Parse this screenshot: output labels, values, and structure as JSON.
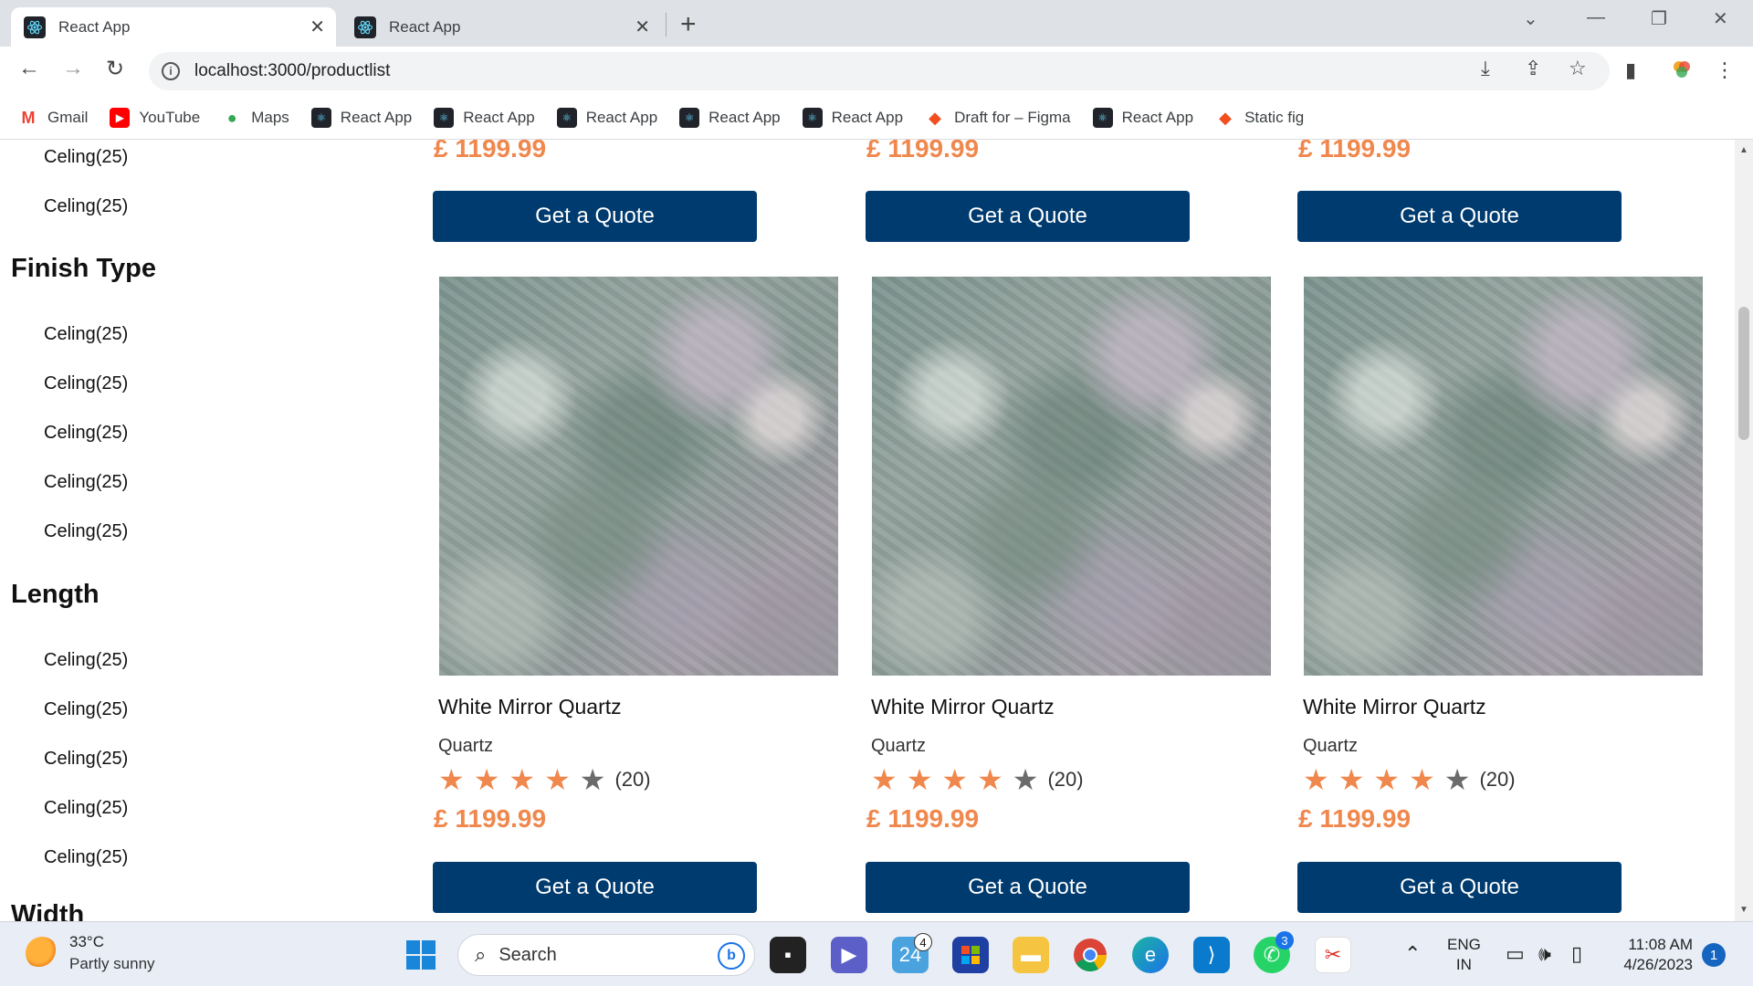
{
  "browser": {
    "tabs": [
      {
        "title": "React App",
        "active": true
      },
      {
        "title": "React App",
        "active": false
      }
    ],
    "new_tab": "+",
    "url": "localhost:3000/productlist",
    "bookmarks": [
      {
        "label": "Gmail",
        "icon": "gmail-icon",
        "color": "#ea4335"
      },
      {
        "label": "YouTube",
        "icon": "youtube-icon",
        "color": "#ff0000"
      },
      {
        "label": "Maps",
        "icon": "maps-icon",
        "color": "#34a853"
      },
      {
        "label": "React App",
        "icon": "react-icon",
        "color": "#20232a"
      },
      {
        "label": "React App",
        "icon": "react-icon",
        "color": "#20232a"
      },
      {
        "label": "React App",
        "icon": "react-icon",
        "color": "#20232a"
      },
      {
        "label": "React App",
        "icon": "react-icon",
        "color": "#20232a"
      },
      {
        "label": "React App",
        "icon": "react-icon",
        "color": "#20232a"
      },
      {
        "label": "Draft for – Figma",
        "icon": "figma-icon",
        "color": "#f24e1e"
      },
      {
        "label": "React App",
        "icon": "react-icon",
        "color": "#20232a"
      },
      {
        "label": "Static fig",
        "icon": "figma-icon",
        "color": "#f24e1e"
      }
    ]
  },
  "sidebar": {
    "top_items": [
      "Celing(25)",
      "Celing(25)"
    ],
    "finish_type": {
      "heading": "Finish Type",
      "items": [
        "Celing(25)",
        "Celing(25)",
        "Celing(25)",
        "Celing(25)",
        "Celing(25)"
      ]
    },
    "length": {
      "heading": "Length",
      "items": [
        "Celing(25)",
        "Celing(25)",
        "Celing(25)",
        "Celing(25)",
        "Celing(25)"
      ]
    },
    "next_heading": "Width"
  },
  "products": {
    "top_row": [
      {
        "price": "£ 1199.99",
        "button": "Get a Quote"
      },
      {
        "price": "£ 1199.99",
        "button": "Get a Quote"
      },
      {
        "price": "£ 1199.99",
        "button": "Get a Quote"
      }
    ],
    "cards": [
      {
        "name": "White Mirror Quartz",
        "category": "Quartz",
        "rating": 4,
        "rating_max": 5,
        "review_count": "(20)",
        "price": "£ 1199.99",
        "button": "Get a Quote"
      },
      {
        "name": "White Mirror Quartz",
        "category": "Quartz",
        "rating": 4,
        "rating_max": 5,
        "review_count": "(20)",
        "price": "£ 1199.99",
        "button": "Get a Quote"
      },
      {
        "name": "White Mirror Quartz",
        "category": "Quartz",
        "rating": 4,
        "rating_max": 5,
        "review_count": "(20)",
        "price": "£ 1199.99",
        "button": "Get a Quote"
      }
    ]
  },
  "colors": {
    "price": "#f0874d",
    "button_bg": "#003b6f",
    "star_on": "#f0874d",
    "star_off": "#6b6b6b"
  },
  "taskbar": {
    "weather_temp": "33°C",
    "weather_desc": "Partly sunny",
    "search_placeholder": "Search",
    "badge_calendar": "4",
    "badge_whatsapp": "3",
    "lang_line1": "ENG",
    "lang_line2": "IN",
    "time": "11:08 AM",
    "date": "4/26/2023",
    "notifications": "1"
  }
}
